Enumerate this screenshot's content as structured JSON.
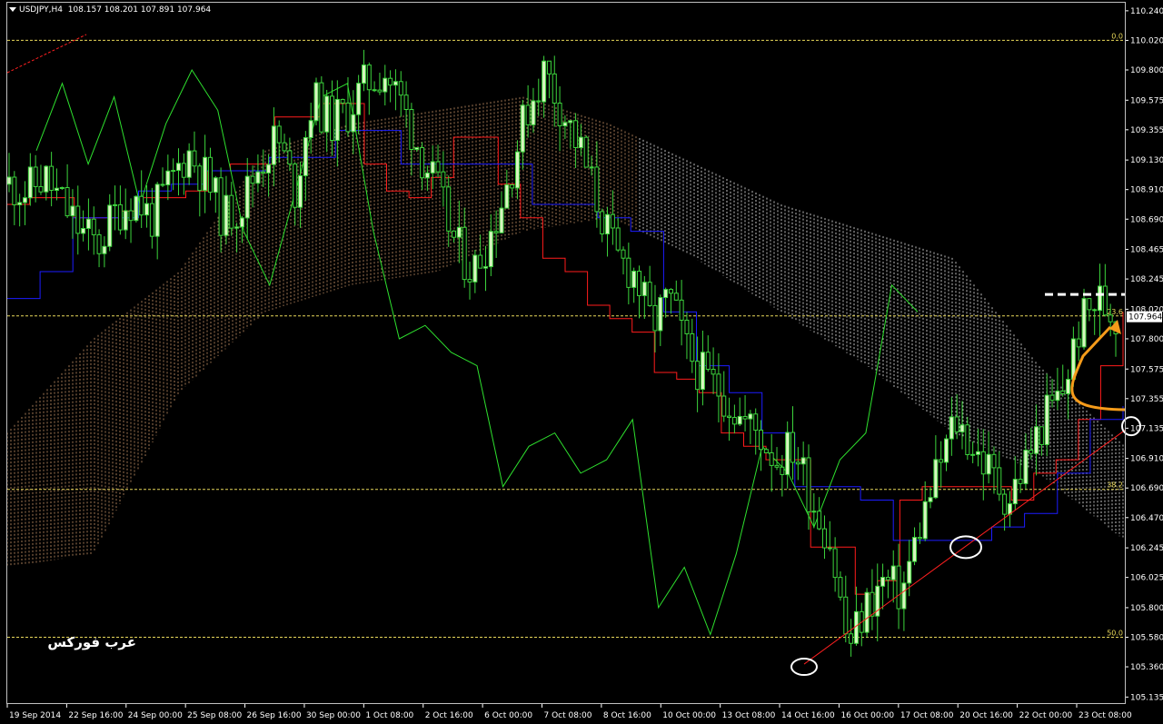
{
  "header": {
    "symbol": "USDJPY,H4",
    "ohlc": "108.157 108.201 107.891 107.964"
  },
  "price_axis": {
    "labels": [
      "110.240",
      "110.020",
      "109.800",
      "109.575",
      "109.355",
      "109.130",
      "108.910",
      "108.690",
      "108.465",
      "108.245",
      "108.020",
      "107.800",
      "107.575",
      "107.355",
      "107.135",
      "106.910",
      "106.690",
      "106.470",
      "106.245",
      "106.025",
      "105.800",
      "105.580",
      "105.360",
      "105.135"
    ],
    "current_price": "107.964"
  },
  "time_axis": {
    "labels": [
      "19 Sep 2014",
      "22 Sep 16:00",
      "24 Sep 00:00",
      "25 Sep 08:00",
      "26 Sep 16:00",
      "30 Sep 00:00",
      "1 Oct 08:00",
      "2 Oct 16:00",
      "6 Oct 00:00",
      "7 Oct 08:00",
      "8 Oct 16:00",
      "10 Oct 00:00",
      "13 Oct 08:00",
      "14 Oct 16:00",
      "16 Oct 00:00",
      "17 Oct 08:00",
      "20 Oct 16:00",
      "22 Oct 00:00",
      "23 Oct 08:00"
    ]
  },
  "fibonacci": {
    "levels": [
      {
        "label": "0.0",
        "price": 110.02
      },
      {
        "label": "23.6",
        "price": 107.97
      },
      {
        "label": "38.2",
        "price": 106.68
      },
      {
        "label": "50.0",
        "price": 105.58
      }
    ]
  },
  "watermark": "عرب فوركس",
  "colors": {
    "background": "#000000",
    "bull_candle": "#d8f5c0",
    "bear_candle": "#d8f5c0",
    "wick": "#3cd43c",
    "tenkan": "#ff1c1c",
    "kijun": "#1c1cff",
    "chikou": "#2ee02e",
    "cloud": "#d9a070",
    "cloud_alt": "#ffffff",
    "fib": "#e8d85a",
    "trendline": "#ff2020",
    "arrow": "#f59b1a",
    "circles": "#ffffff"
  },
  "chart_data": {
    "type": "candlestick",
    "title": "USDJPY,H4",
    "ylim": [
      105.135,
      110.24
    ],
    "x": [
      "19 Sep 2014",
      "22 Sep 16:00",
      "24 Sep 00:00",
      "25 Sep 08:00",
      "26 Sep 16:00",
      "30 Sep 00:00",
      "1 Oct 08:00",
      "2 Oct 16:00",
      "6 Oct 00:00",
      "7 Oct 08:00",
      "8 Oct 16:00",
      "10 Oct 00:00",
      "13 Oct 08:00",
      "14 Oct 16:00",
      "16 Oct 00:00",
      "17 Oct 08:00",
      "20 Oct 16:00",
      "22 Oct 00:00",
      "23 Oct 08:00"
    ],
    "close_path": [
      108.95,
      108.9,
      109.0,
      108.8,
      108.6,
      108.5,
      108.75,
      108.85,
      108.7,
      108.95,
      109.2,
      109.0,
      108.7,
      108.8,
      109.1,
      109.3,
      108.9,
      109.6,
      109.4,
      109.5,
      109.7,
      109.8,
      109.55,
      109.2,
      108.9,
      108.5,
      108.3,
      108.6,
      109.0,
      109.5,
      109.8,
      109.5,
      109.2,
      108.8,
      108.4,
      108.3,
      107.9,
      108.1,
      107.7,
      107.5,
      107.4,
      107.2,
      107.1,
      106.9,
      107.0,
      106.6,
      106.3,
      105.5,
      105.8,
      106.0,
      105.9,
      106.4,
      106.8,
      107.2,
      107.0,
      106.8,
      106.6,
      106.9,
      107.2,
      107.4,
      107.9,
      108.1,
      107.96
    ],
    "series": [
      {
        "name": "Tenkan-sen",
        "values": [
          108.8,
          108.85,
          108.85,
          108.7,
          108.7,
          108.75,
          108.85,
          108.85,
          108.9,
          109.05,
          109.1,
          109.1,
          109.45,
          109.45,
          109.55,
          109.55,
          109.1,
          108.9,
          108.85,
          109.0,
          109.3,
          109.3,
          108.95,
          108.7,
          108.4,
          108.3,
          108.05,
          107.95,
          107.85,
          107.55,
          107.5,
          107.4,
          107.1,
          107.0,
          106.9,
          106.9,
          106.25,
          106.25,
          105.9,
          106.0,
          106.6,
          106.7,
          106.7,
          106.7,
          106.7,
          106.6,
          106.8,
          106.9,
          107.2,
          107.6,
          108.0
        ]
      },
      {
        "name": "Kijun-sen",
        "values": [
          108.1,
          108.3,
          108.7,
          108.7,
          108.9,
          108.95,
          109.05,
          109.05,
          109.15,
          109.15,
          109.35,
          109.35,
          109.1,
          109.1,
          109.1,
          109.1,
          108.8,
          108.8,
          108.7,
          108.6,
          108.0,
          107.6,
          107.4,
          107.1,
          106.7,
          106.7,
          106.6,
          106.3,
          106.3,
          106.3,
          106.4,
          106.5,
          106.8,
          107.2,
          107.3
        ]
      },
      {
        "name": "Chikou Span",
        "values": [
          109.2,
          109.7,
          109.1,
          109.6,
          108.8,
          109.4,
          109.8,
          109.5,
          108.6,
          108.2,
          108.9,
          109.6,
          109.7,
          108.6,
          107.8,
          107.9,
          107.7,
          107.6,
          106.7,
          107.0,
          107.1,
          106.8,
          106.9,
          107.2,
          105.8,
          106.1,
          105.6,
          106.2,
          107.0,
          106.8,
          106.4,
          106.9,
          107.1,
          108.2,
          108.0
        ]
      }
    ],
    "cloud_range": [
      [
        106.1,
        107.1
      ],
      [
        106.2,
        107.8
      ],
      [
        107.4,
        108.3
      ],
      [
        108.0,
        109.2
      ],
      [
        108.2,
        109.4
      ],
      [
        108.3,
        109.5
      ],
      [
        108.6,
        109.6
      ],
      [
        108.7,
        109.4
      ],
      [
        108.4,
        109.1
      ],
      [
        108.0,
        108.8
      ],
      [
        107.6,
        108.6
      ],
      [
        107.1,
        108.4
      ],
      [
        106.8,
        107.6
      ],
      [
        106.3,
        107.0
      ]
    ],
    "annotations": [
      "ellipse low 105.36",
      "ellipse low 106.25",
      "trendline support",
      "dashed resistance 108.13",
      "orange arrow up"
    ]
  }
}
